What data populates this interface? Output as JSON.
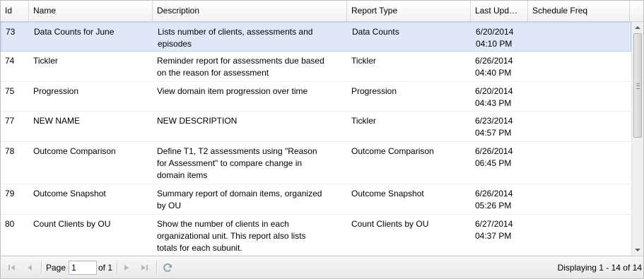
{
  "columns": [
    "Id",
    "Name",
    "Description",
    "Report Type",
    "Last Upd…",
    "Schedule Freq"
  ],
  "rows": [
    {
      "id": "73",
      "name": "Data Counts for June",
      "desc": [
        "Lists number of clients, assessments and",
        "episodes"
      ],
      "type": "Data Counts",
      "date": "6/20/2014",
      "time": "04:10 PM",
      "freq": ""
    },
    {
      "id": "74",
      "name": "Tickler",
      "desc": [
        "Reminder report for assessments due based",
        "on the reason for assessment"
      ],
      "type": "Tickler",
      "date": "6/26/2014",
      "time": "04:40 PM",
      "freq": ""
    },
    {
      "id": "75",
      "name": "Progression",
      "desc": [
        "View domain item progression over time"
      ],
      "type": "Progression",
      "date": "6/20/2014",
      "time": "04:43 PM",
      "freq": ""
    },
    {
      "id": "77",
      "name": "NEW NAME",
      "desc": [
        "NEW DESCRIPTION"
      ],
      "type": "Tickler",
      "date": "6/23/2014",
      "time": "04:57 PM",
      "freq": ""
    },
    {
      "id": "78",
      "name": "Outcome Comparison",
      "desc": [
        "Define T1, T2 assessments using \"Reason",
        "for Assessment\" to compare change in",
        "domain items"
      ],
      "type": "Outcome Comparison",
      "date": "6/26/2014",
      "time": "06:45 PM",
      "freq": ""
    },
    {
      "id": "79",
      "name": "Outcome Snapshot",
      "desc": [
        "Summary report of domain items, organized",
        "by OU"
      ],
      "type": "Outcome Snapshot",
      "date": "6/26/2014",
      "time": "05:26 PM",
      "freq": ""
    },
    {
      "id": "80",
      "name": "Count Clients by OU",
      "desc": [
        "Show the number of clients in each",
        "organizational unit. This report also lists",
        "totals for each subunit."
      ],
      "type": "Count Clients by OU",
      "date": "6/27/2014",
      "time": "04:37 PM",
      "freq": ""
    }
  ],
  "paging": {
    "page_label": "Page",
    "page_value": "1",
    "of_label": "of 1",
    "displaying": "Displaying 1 - 14 of 14"
  },
  "icons": [
    "first-page-icon",
    "prev-page-icon",
    "next-page-icon",
    "last-page-icon",
    "refresh-icon"
  ],
  "colors": {
    "selected_row": "#dfe8f6"
  }
}
